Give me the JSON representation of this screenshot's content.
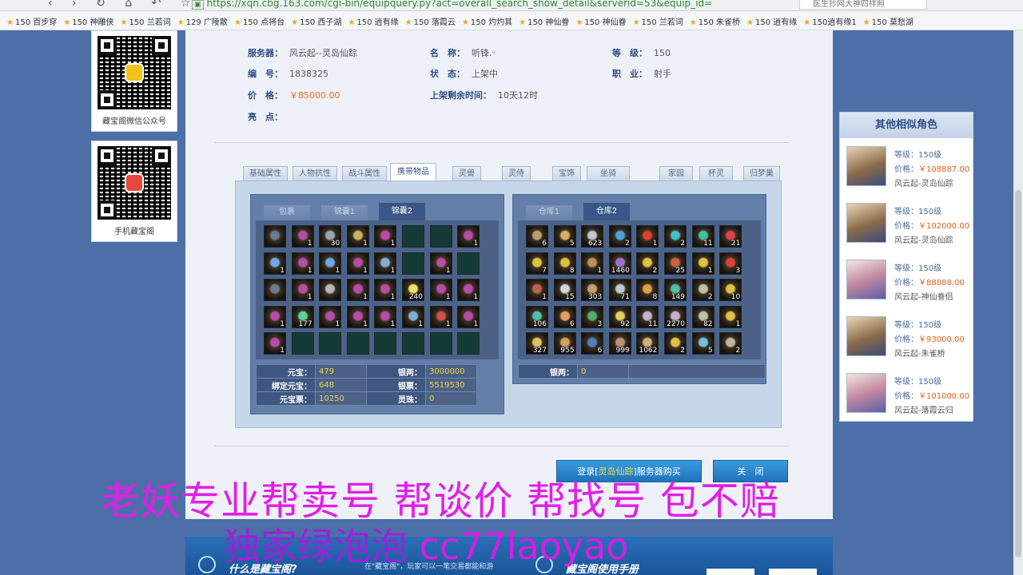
{
  "browser": {
    "url": "https://xqn.cbg.163.com/cgi-bin/equipquery.py?act=overall_search_show_detail&serverid=53&equip_id=",
    "search_placeholder": "医生抄网大神四样照",
    "bookmarks": [
      "150 百步穿",
      "150 神雕侠",
      "150 兰若词",
      "129 广陵散",
      "150 点将台",
      "150 西子湖",
      "150 逍有缘",
      "150 落霞云",
      "150 灼灼其",
      "150 神仙眷",
      "150 神仙眷",
      "150 兰若词",
      "150 朱雀桥",
      "150 逍有缘",
      "150逍有缘1",
      "150 莫愁湖"
    ]
  },
  "qr_cards": [
    {
      "caption": "藏宝阁微信公众号",
      "logo_color": "#f5c21b"
    },
    {
      "caption": "手机藏宝阁",
      "logo_color": "#e8473a"
    }
  ],
  "info": {
    "server_label": "服务器：",
    "server": "风云起--灵岛仙踪",
    "name_label": "名　称：",
    "name": "听锋.ᵕ",
    "level_label": "等　级：",
    "level": "150",
    "id_label": "编　号：",
    "id": "1838325",
    "status_label": "状　态：",
    "status": "上架中",
    "job_label": "职　业：",
    "job": "射手",
    "price_label": "价　格：",
    "price": "￥85000.00",
    "time_label": "上架剩余时间：",
    "time": "10天12时",
    "highlight_label": "亮　点："
  },
  "tabs": [
    "基础属性",
    "人物抗性",
    "战斗属性",
    "携带物品",
    "灵兽",
    "灵侍",
    "宝饰",
    "坐骑",
    "家园",
    "杯灵",
    "归梦巢"
  ],
  "active_tab": "携带物品",
  "bag": {
    "tabs": [
      "包裹",
      "锦囊1",
      "锦囊2"
    ],
    "active": "锦囊2",
    "rows": [
      [
        {
          "c": "#6d7a90"
        },
        {
          "c": "#b84ca8",
          "q": "1"
        },
        {
          "c": "#9aa4b0",
          "q": "30"
        },
        {
          "c": "#c9b25a",
          "q": "1"
        },
        {
          "c": "#b84ca8",
          "q": "1"
        },
        null,
        null,
        {
          "c": "#b84ca8",
          "q": "1"
        }
      ],
      [
        {
          "c": "#6fa8e8",
          "q": "1"
        },
        {
          "c": "#b84ca8",
          "q": "1"
        },
        {
          "c": "#6fa8e8",
          "q": "1"
        },
        {
          "c": "#b84ca8",
          "q": "1"
        },
        {
          "c": "#7fb0d8",
          "q": "1"
        },
        null,
        {
          "c": "#b84ca8",
          "q": "1"
        },
        null
      ],
      [
        {
          "c": "#6d7a90"
        },
        {
          "c": "#b84ca8",
          "q": "1"
        },
        {
          "c": "#b8b8b8"
        },
        {
          "c": "#b84ca8",
          "q": "1"
        },
        {
          "c": "#b84ca8",
          "q": "1"
        },
        {
          "c": "#f0e060",
          "q": "240"
        },
        {
          "c": "#b84ca8",
          "q": "1"
        },
        {
          "c": "#b84ca8",
          "q": "1"
        }
      ],
      [
        {
          "c": "#b84ca8",
          "q": "1"
        },
        {
          "c": "#5fd0a0",
          "q": "177"
        },
        {
          "c": "#b84ca8",
          "q": "1"
        },
        {
          "c": "#b84ca8",
          "q": "1"
        },
        {
          "c": "#b84ca8",
          "q": "1"
        },
        {
          "c": "#7fb0d8",
          "q": "1"
        },
        {
          "c": "#d05050",
          "q": "1"
        },
        {
          "c": "#b84ca8",
          "q": "1"
        }
      ],
      [
        {
          "c": "#b84ca8",
          "q": "1"
        },
        null,
        null,
        null,
        null,
        null,
        null,
        null
      ]
    ],
    "stats": [
      [
        "元宝：",
        "479",
        "银两：",
        "3000000"
      ],
      [
        "绑定元宝：",
        "648",
        "银票：",
        "5519530"
      ],
      [
        "元宝票：",
        "10250",
        "灵珠：",
        "0"
      ]
    ]
  },
  "warehouse": {
    "tabs": [
      "仓库1",
      "仓库2"
    ],
    "active": "仓库2",
    "rows": [
      [
        {
          "c": "#b8a070",
          "q": "6"
        },
        {
          "c": "#d8b060",
          "q": "5"
        },
        {
          "c": "#c0c8d0",
          "q": "623"
        },
        {
          "c": "#50a0e0",
          "q": "2"
        },
        {
          "c": "#e04030",
          "q": "1"
        },
        {
          "c": "#40c0c0",
          "q": "2"
        },
        {
          "c": "#40c0a0",
          "q": "11"
        },
        {
          "c": "#e04050",
          "q": "21"
        }
      ],
      [
        {
          "c": "#e0c040",
          "q": "7"
        },
        {
          "c": "#e0c040",
          "q": "8"
        },
        {
          "c": "#c09050",
          "q": "1"
        },
        {
          "c": "#a070d0",
          "q": "1460"
        },
        {
          "c": "#e0c040",
          "q": "2"
        },
        {
          "c": "#d06040",
          "q": "25"
        },
        {
          "c": "#e0c040",
          "q": "1"
        },
        {
          "c": "#e04040",
          "q": "3"
        }
      ],
      [
        {
          "c": "#c06050",
          "q": "1"
        },
        {
          "c": "#d0d8e0",
          "q": "15"
        },
        {
          "c": "#c8a070",
          "q": "303"
        },
        {
          "c": "#c0c8d8",
          "q": "71"
        },
        {
          "c": "#e0a040",
          "q": "8"
        },
        {
          "c": "#50c0a0",
          "q": "149"
        },
        {
          "c": "#c0c0a0",
          "q": "2"
        },
        {
          "c": "#e0c040",
          "q": "10"
        }
      ],
      [
        {
          "c": "#50c0b0",
          "q": "106"
        },
        {
          "c": "#e0a060",
          "q": "6"
        },
        {
          "c": "#50b070",
          "q": "3"
        },
        {
          "c": "#e0d060",
          "q": "92"
        },
        {
          "c": "#c8b0d0",
          "q": "11"
        },
        {
          "c": "#c8b0d0",
          "q": "2270"
        },
        {
          "c": "#c0c0b0",
          "q": "82"
        },
        {
          "c": "#e0c040",
          "q": "1"
        }
      ],
      [
        {
          "c": "#e0c060",
          "q": "327"
        },
        {
          "c": "#d8a060",
          "q": "955"
        },
        {
          "c": "#5080c0",
          "q": "6"
        },
        {
          "c": "#c09070",
          "q": "999"
        },
        {
          "c": "#d0b080",
          "q": "1062"
        },
        {
          "c": "#e0c040",
          "q": "2"
        },
        {
          "c": "#70c0e0",
          "q": "5"
        },
        {
          "c": "#c0b8a0",
          "q": "2"
        }
      ]
    ],
    "stats": [
      [
        "银两：",
        "0"
      ]
    ]
  },
  "buttons": {
    "login_prefix": "登录[",
    "login_server": "灵岛仙踪",
    "login_suffix": "]服务器购买",
    "close": "关　闭"
  },
  "similar": {
    "title": "其他相似角色",
    "items": [
      {
        "level": "等级：150级",
        "price_label": "价格：",
        "price": "￥108887.00",
        "server": "风云起-灵岛仙踪",
        "female": false
      },
      {
        "level": "等级：150级",
        "price_label": "价格：",
        "price": "￥102000.00",
        "server": "风云起-灵岛仙踪",
        "female": false
      },
      {
        "level": "等级：150级",
        "price_label": "价格：",
        "price": "￥88888.00",
        "server": "风云起-神仙眷侣",
        "female": true
      },
      {
        "level": "等级：150级",
        "price_label": "价格：",
        "price": "￥93000.00",
        "server": "风云起-朱雀桥",
        "female": false
      },
      {
        "level": "等级：150级",
        "price_label": "价格：",
        "price": "￥101000.00",
        "server": "风云起-落霞云归",
        "female": true
      }
    ]
  },
  "footer": {
    "what": "什么是藏宝阁?",
    "desc": "在\"藏宝阁\"，玩家可以一笔交易都能和游",
    "guide": "藏宝阁使用手册"
  },
  "overlay": {
    "line1": "老妖专业帮卖号 帮谈价 帮找号 包不赔",
    "line2_cn": "独家绿泡泡 ",
    "line2_en": "cc77laoyao"
  }
}
